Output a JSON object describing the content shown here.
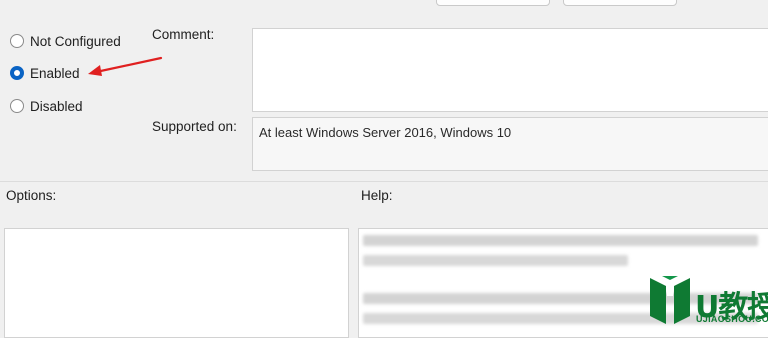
{
  "state": {
    "radio_options": [
      {
        "label": "Not Configured",
        "checked": false
      },
      {
        "label": "Enabled",
        "checked": true
      },
      {
        "label": "Disabled",
        "checked": false
      }
    ]
  },
  "fields": {
    "comment_label": "Comment:",
    "comment_value": "",
    "supported_label": "Supported on:",
    "supported_value": "At least Windows Server 2016, Windows 10"
  },
  "panels": {
    "options_label": "Options:",
    "help_label": "Help:"
  },
  "watermark": {
    "brand": "U教授",
    "url": "UJIAOSHOU.COM"
  },
  "annotation": {
    "arrow_color": "#e02020"
  },
  "colors": {
    "accent": "#0a63c4",
    "logo_green": "#0f7a33"
  },
  "icons": [
    "chevron-down-icon",
    "arrow-annotation",
    "watermark-logo"
  ]
}
